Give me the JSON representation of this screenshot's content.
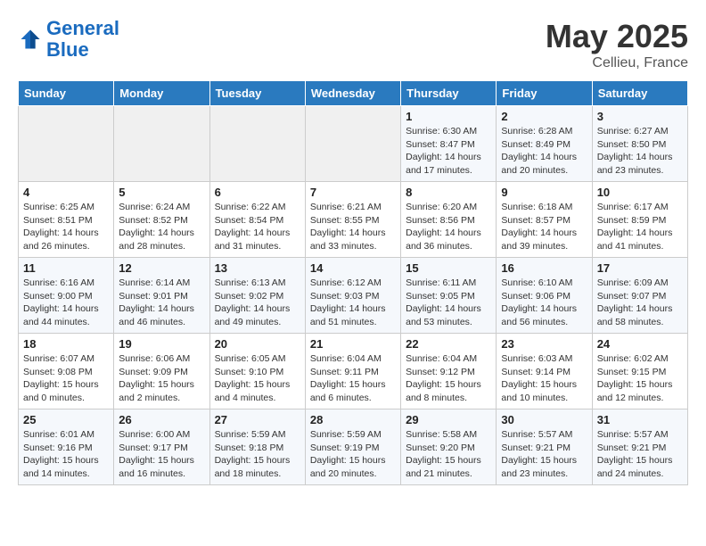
{
  "header": {
    "logo_line1": "General",
    "logo_line2": "Blue",
    "month_year": "May 2025",
    "location": "Cellieu, France"
  },
  "weekdays": [
    "Sunday",
    "Monday",
    "Tuesday",
    "Wednesday",
    "Thursday",
    "Friday",
    "Saturday"
  ],
  "weeks": [
    [
      {
        "day": "",
        "content": ""
      },
      {
        "day": "",
        "content": ""
      },
      {
        "day": "",
        "content": ""
      },
      {
        "day": "",
        "content": ""
      },
      {
        "day": "1",
        "content": "Sunrise: 6:30 AM\nSunset: 8:47 PM\nDaylight: 14 hours\nand 17 minutes."
      },
      {
        "day": "2",
        "content": "Sunrise: 6:28 AM\nSunset: 8:49 PM\nDaylight: 14 hours\nand 20 minutes."
      },
      {
        "day": "3",
        "content": "Sunrise: 6:27 AM\nSunset: 8:50 PM\nDaylight: 14 hours\nand 23 minutes."
      }
    ],
    [
      {
        "day": "4",
        "content": "Sunrise: 6:25 AM\nSunset: 8:51 PM\nDaylight: 14 hours\nand 26 minutes."
      },
      {
        "day": "5",
        "content": "Sunrise: 6:24 AM\nSunset: 8:52 PM\nDaylight: 14 hours\nand 28 minutes."
      },
      {
        "day": "6",
        "content": "Sunrise: 6:22 AM\nSunset: 8:54 PM\nDaylight: 14 hours\nand 31 minutes."
      },
      {
        "day": "7",
        "content": "Sunrise: 6:21 AM\nSunset: 8:55 PM\nDaylight: 14 hours\nand 33 minutes."
      },
      {
        "day": "8",
        "content": "Sunrise: 6:20 AM\nSunset: 8:56 PM\nDaylight: 14 hours\nand 36 minutes."
      },
      {
        "day": "9",
        "content": "Sunrise: 6:18 AM\nSunset: 8:57 PM\nDaylight: 14 hours\nand 39 minutes."
      },
      {
        "day": "10",
        "content": "Sunrise: 6:17 AM\nSunset: 8:59 PM\nDaylight: 14 hours\nand 41 minutes."
      }
    ],
    [
      {
        "day": "11",
        "content": "Sunrise: 6:16 AM\nSunset: 9:00 PM\nDaylight: 14 hours\nand 44 minutes."
      },
      {
        "day": "12",
        "content": "Sunrise: 6:14 AM\nSunset: 9:01 PM\nDaylight: 14 hours\nand 46 minutes."
      },
      {
        "day": "13",
        "content": "Sunrise: 6:13 AM\nSunset: 9:02 PM\nDaylight: 14 hours\nand 49 minutes."
      },
      {
        "day": "14",
        "content": "Sunrise: 6:12 AM\nSunset: 9:03 PM\nDaylight: 14 hours\nand 51 minutes."
      },
      {
        "day": "15",
        "content": "Sunrise: 6:11 AM\nSunset: 9:05 PM\nDaylight: 14 hours\nand 53 minutes."
      },
      {
        "day": "16",
        "content": "Sunrise: 6:10 AM\nSunset: 9:06 PM\nDaylight: 14 hours\nand 56 minutes."
      },
      {
        "day": "17",
        "content": "Sunrise: 6:09 AM\nSunset: 9:07 PM\nDaylight: 14 hours\nand 58 minutes."
      }
    ],
    [
      {
        "day": "18",
        "content": "Sunrise: 6:07 AM\nSunset: 9:08 PM\nDaylight: 15 hours\nand 0 minutes."
      },
      {
        "day": "19",
        "content": "Sunrise: 6:06 AM\nSunset: 9:09 PM\nDaylight: 15 hours\nand 2 minutes."
      },
      {
        "day": "20",
        "content": "Sunrise: 6:05 AM\nSunset: 9:10 PM\nDaylight: 15 hours\nand 4 minutes."
      },
      {
        "day": "21",
        "content": "Sunrise: 6:04 AM\nSunset: 9:11 PM\nDaylight: 15 hours\nand 6 minutes."
      },
      {
        "day": "22",
        "content": "Sunrise: 6:04 AM\nSunset: 9:12 PM\nDaylight: 15 hours\nand 8 minutes."
      },
      {
        "day": "23",
        "content": "Sunrise: 6:03 AM\nSunset: 9:14 PM\nDaylight: 15 hours\nand 10 minutes."
      },
      {
        "day": "24",
        "content": "Sunrise: 6:02 AM\nSunset: 9:15 PM\nDaylight: 15 hours\nand 12 minutes."
      }
    ],
    [
      {
        "day": "25",
        "content": "Sunrise: 6:01 AM\nSunset: 9:16 PM\nDaylight: 15 hours\nand 14 minutes."
      },
      {
        "day": "26",
        "content": "Sunrise: 6:00 AM\nSunset: 9:17 PM\nDaylight: 15 hours\nand 16 minutes."
      },
      {
        "day": "27",
        "content": "Sunrise: 5:59 AM\nSunset: 9:18 PM\nDaylight: 15 hours\nand 18 minutes."
      },
      {
        "day": "28",
        "content": "Sunrise: 5:59 AM\nSunset: 9:19 PM\nDaylight: 15 hours\nand 20 minutes."
      },
      {
        "day": "29",
        "content": "Sunrise: 5:58 AM\nSunset: 9:20 PM\nDaylight: 15 hours\nand 21 minutes."
      },
      {
        "day": "30",
        "content": "Sunrise: 5:57 AM\nSunset: 9:21 PM\nDaylight: 15 hours\nand 23 minutes."
      },
      {
        "day": "31",
        "content": "Sunrise: 5:57 AM\nSunset: 9:21 PM\nDaylight: 15 hours\nand 24 minutes."
      }
    ]
  ]
}
